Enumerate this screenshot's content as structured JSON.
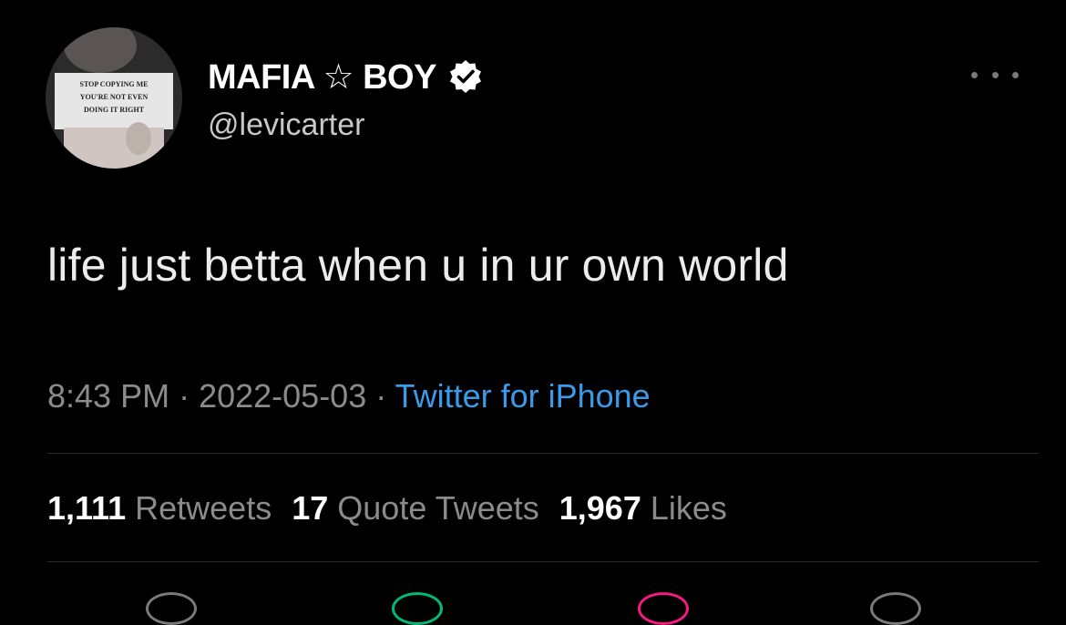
{
  "author": {
    "display_name": "MAFIA ☆ BOY",
    "handle": "@levicarter",
    "avatar_shirt_lines": [
      "STOP COPYING ME",
      "YOU'RE NOT EVEN",
      "DOING IT RIGHT"
    ]
  },
  "tweet": {
    "text": "life just betta when u in ur own world",
    "time": "8:43 PM",
    "separator": " · ",
    "date": "2022-05-03",
    "source": "Twitter for iPhone"
  },
  "stats": {
    "retweets_count": "1,111",
    "retweets_label": "Retweets",
    "quotes_count": "17",
    "quotes_label": "Quote Tweets",
    "likes_count": "1,967",
    "likes_label": "Likes"
  },
  "icons": {
    "verified": "verified-badge-icon",
    "more": "more-options-icon",
    "reply": "reply-icon",
    "retweet": "retweet-icon",
    "like": "like-icon",
    "share": "share-icon"
  },
  "colors": {
    "background": "#000000",
    "link": "#3b9be8",
    "like_accent": "#f91880",
    "retweet_accent": "#00ba7c"
  }
}
